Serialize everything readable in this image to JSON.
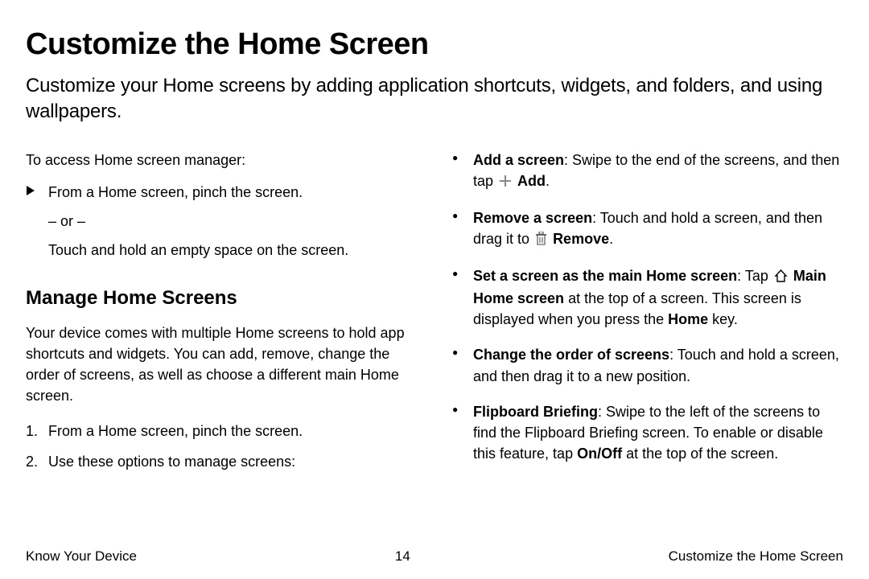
{
  "title": "Customize the Home Screen",
  "intro": "Customize your Home screens by adding application shortcuts, widgets, and folders, and using wallpapers.",
  "left": {
    "access_lead": "To access Home screen manager:",
    "pinch": "From a Home screen, pinch the screen.",
    "or": "– or –",
    "hold": "Touch and hold an empty space on the screen.",
    "subhead": "Manage Home Screens",
    "manage_para": "Your device comes with multiple Home screens to hold app shortcuts and widgets. You can add, remove, change the order of screens, as well as choose a different main Home screen.",
    "steps": [
      "From a Home screen, pinch the screen.",
      "Use these options to manage screens:"
    ]
  },
  "right": {
    "items": [
      {
        "label": "Add a screen",
        "text1": ": Swipe to the end of the screens, and then tap ",
        "icon": "plus",
        "iconLabel": "Add",
        "text2": "."
      },
      {
        "label": "Remove a screen",
        "text1": ": Touch and hold a screen, and then drag it to ",
        "icon": "trash",
        "iconLabel": "Remove",
        "text2": "."
      },
      {
        "label": "Set a screen as the main Home screen",
        "text1": ": Tap ",
        "icon": "home",
        "iconLabel": "Main Home screen",
        "text2": " at the top of a screen. This screen is displayed when you press the ",
        "bold2": "Home",
        "text3": " key."
      },
      {
        "label": "Change the order of screens",
        "text1": ": Touch and hold a screen, and then drag it to a new position."
      },
      {
        "label": "Flipboard Briefing",
        "text1": ": Swipe to the left of the screens to find the Flipboard Briefing screen. To enable or disable this feature, tap ",
        "bold2": "On/Off",
        "text3": " at the top of the screen."
      }
    ]
  },
  "footer": {
    "left": "Know Your Device",
    "center": "14",
    "right": "Customize the Home Screen"
  }
}
